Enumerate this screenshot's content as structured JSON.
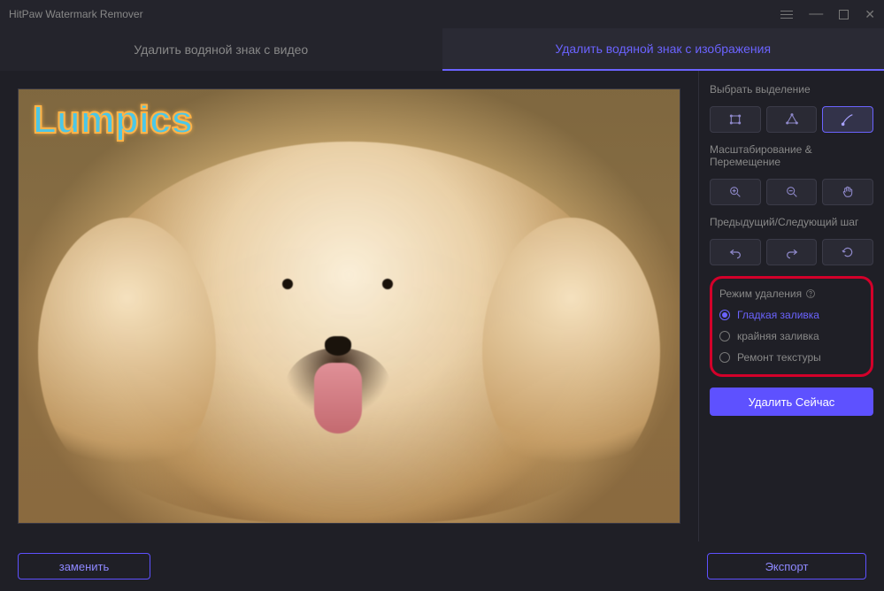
{
  "titlebar": {
    "title": "HitPaw Watermark Remover"
  },
  "tabs": {
    "video": "Удалить водяной знак с видео",
    "image": "Удалить водяной знак с изображения",
    "active": "image"
  },
  "canvas": {
    "watermark_text": "Lumpics"
  },
  "sidebar": {
    "selection_label": "Выбрать выделение",
    "zoom_label": "Масштабирование & Перемещение",
    "history_label": "Предыдущий/Следующий шаг",
    "mode_label": "Режим удаления",
    "modes": [
      {
        "label": "Гладкая заливка",
        "selected": true
      },
      {
        "label": "крайняя заливка",
        "selected": false
      },
      {
        "label": "Ремонт текстуры",
        "selected": false
      }
    ],
    "remove_btn": "Удалить Сейчас"
  },
  "footer": {
    "replace": "заменить",
    "export": "Экспорт"
  },
  "icons": {
    "rect": "rect-select-icon",
    "lasso": "lasso-select-icon",
    "brush": "brush-select-icon",
    "zoom_in": "zoom-in-icon",
    "zoom_out": "zoom-out-icon",
    "pan": "pan-hand-icon",
    "undo": "undo-icon",
    "redo": "redo-icon",
    "reset": "reset-icon",
    "help": "help-icon"
  }
}
